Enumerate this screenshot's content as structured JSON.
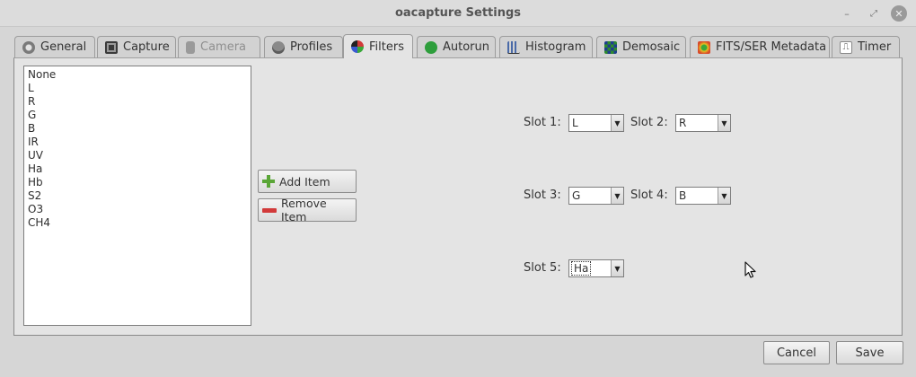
{
  "window": {
    "title": "oacapture Settings"
  },
  "tabs": [
    {
      "label": "General",
      "icon": "gear-icon"
    },
    {
      "label": "Capture",
      "icon": "floppy-icon"
    },
    {
      "label": "Camera",
      "icon": "camera-icon"
    },
    {
      "label": "Profiles",
      "icon": "profile-icon"
    },
    {
      "label": "Filters",
      "icon": "filter-wheel-icon"
    },
    {
      "label": "Autorun",
      "icon": "autorun-icon"
    },
    {
      "label": "Histogram",
      "icon": "histogram-icon"
    },
    {
      "label": "Demosaic",
      "icon": "demosaic-icon"
    },
    {
      "label": "FITS/SER Metadata",
      "icon": "metadata-icon"
    },
    {
      "label": "Timer",
      "icon": "timer-icon"
    }
  ],
  "active_tab": "Filters",
  "filters": {
    "items": [
      "None",
      "L",
      "R",
      "G",
      "B",
      "IR",
      "UV",
      "Ha",
      "Hb",
      "S2",
      "O3",
      "CH4"
    ],
    "add_label": "Add Item",
    "remove_label": "Remove Item",
    "slots": [
      {
        "label": "Slot 1:",
        "value": "L"
      },
      {
        "label": "Slot 2:",
        "value": "R"
      },
      {
        "label": "Slot 3:",
        "value": "G"
      },
      {
        "label": "Slot 4:",
        "value": "B"
      },
      {
        "label": "Slot 5:",
        "value": "Ha"
      }
    ]
  },
  "footer": {
    "cancel_label": "Cancel",
    "save_label": "Save"
  },
  "colors": {
    "add_icon": "#5aa637",
    "remove_icon": "#d23a3a",
    "autorun_icon": "#2e9e3c"
  }
}
